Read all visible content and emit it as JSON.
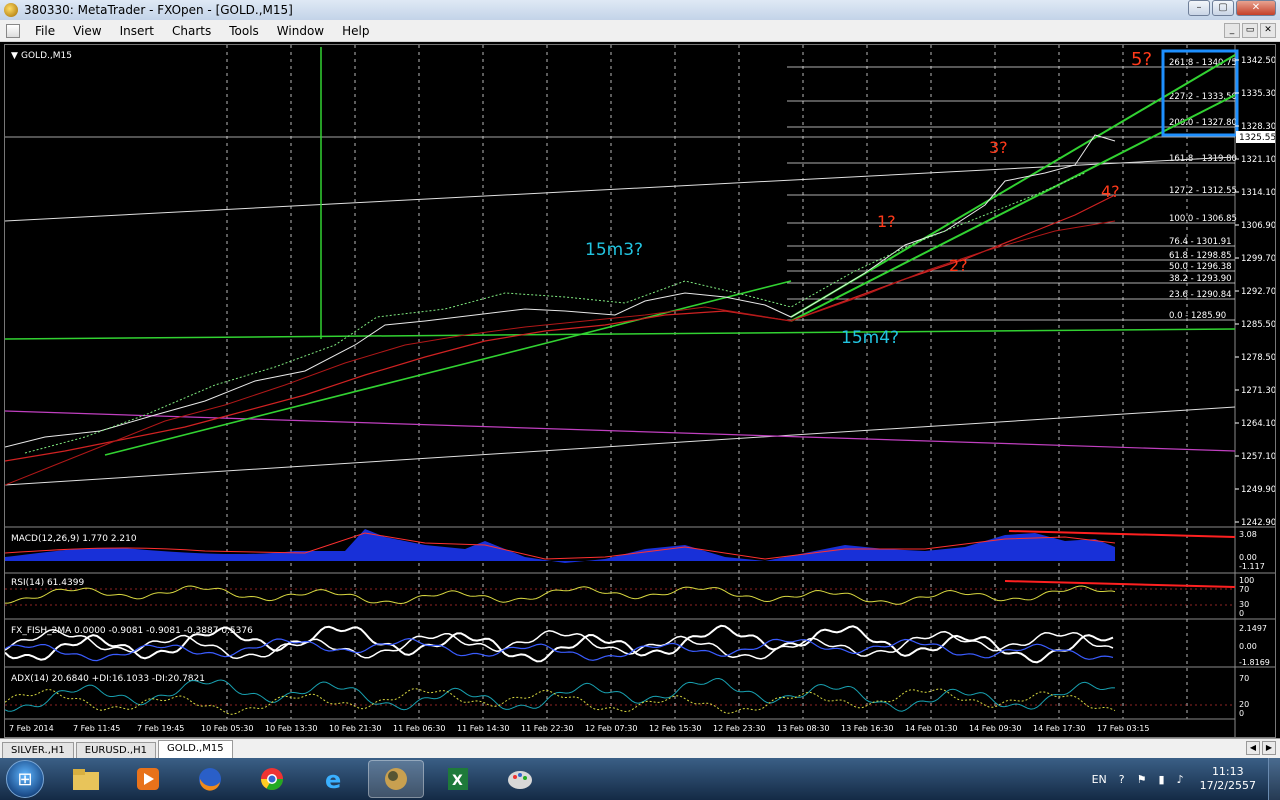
{
  "window": {
    "title": "380330: MetaTrader - FXOpen - [GOLD.,M15]",
    "buttons": {
      "minimize": "–",
      "maximize": "▢",
      "close": "✕"
    }
  },
  "menu": {
    "items": [
      "File",
      "View",
      "Insert",
      "Charts",
      "Tools",
      "Window",
      "Help"
    ],
    "mdi_buttons": [
      "_",
      "▭",
      "✕"
    ]
  },
  "chart": {
    "symbol_label": "GOLD.,M15",
    "current_price": "1325.55",
    "price_ticks": [
      "1342.50",
      "1335.30",
      "1328.30",
      "1321.10",
      "1314.10",
      "1306.90",
      "1299.70",
      "1292.70",
      "1285.50",
      "1278.50",
      "1271.30",
      "1264.10",
      "1257.10",
      "1249.90",
      "1242.90"
    ],
    "time_ticks": [
      "7 Feb 2014",
      "7 Feb 11:45",
      "7 Feb 19:45",
      "10 Feb 05:30",
      "10 Feb 13:30",
      "10 Feb 21:30",
      "11 Feb 06:30",
      "11 Feb 14:30",
      "11 Feb 22:30",
      "12 Feb 07:30",
      "12 Feb 15:30",
      "12 Feb 23:30",
      "13 Feb 08:30",
      "13 Feb 16:30",
      "14 Feb 01:30",
      "14 Feb 09:30",
      "14 Feb 17:30",
      "17 Feb 03:15"
    ],
    "fib_levels": [
      "261.8 - 1340.75",
      "227.2 - 1333.50",
      "200.0 - 1327.80",
      "161.8 - 1319.80",
      "127.2 - 1312.55",
      "100.0 - 1306.85",
      "76.4 - 1301.91",
      "61.8 - 1298.85",
      "50.0 - 1296.38",
      "38.2 - 1293.90",
      "23.6 - 1290.84",
      "0.0 - 1285.90"
    ],
    "annotations": {
      "wave1": "1?",
      "wave2": "2?",
      "wave3": "3?",
      "wave4": "4?",
      "wave5": "5?",
      "m3": "15m3?",
      "m4": "15m4?"
    },
    "colors": {
      "trend": "#32d232",
      "annotation_red": "#ff3a1a",
      "annotation_cyan": "#22c4e0",
      "highlight_box": "#1e90ff",
      "purple": "#c040c0"
    }
  },
  "indicators": {
    "macd": {
      "label": "MACD(12,26,9) 1.770 2.210",
      "ticks": [
        "3.08",
        "0.00",
        "-1.117"
      ]
    },
    "rsi": {
      "label": "RSI(14) 61.4399",
      "ticks": [
        "100",
        "70",
        "30",
        "0"
      ]
    },
    "fish": {
      "label": "FX_FISH_2MA 0.0000 -0.9081 -0.9081 -0.3887 0.5376",
      "ticks": [
        "2.1497",
        "0.00",
        "-1.8169"
      ]
    },
    "adx": {
      "label": "ADX(14) 20.6840 +DI:16.1033 -DI:20.7821",
      "ticks": [
        "70",
        "20",
        "0"
      ]
    }
  },
  "tabs": {
    "items": [
      "SILVER.,H1",
      "EURUSD.,H1",
      "GOLD.,M15"
    ],
    "active": "GOLD.,M15"
  },
  "taskbar": {
    "apps": [
      "folder-icon",
      "media-icon",
      "firefox-icon",
      "chrome-icon",
      "ie-icon",
      "metatrader-icon",
      "excel-icon",
      "paint-icon"
    ],
    "lang": "EN",
    "time": "11:13",
    "date": "17/2/2557"
  }
}
